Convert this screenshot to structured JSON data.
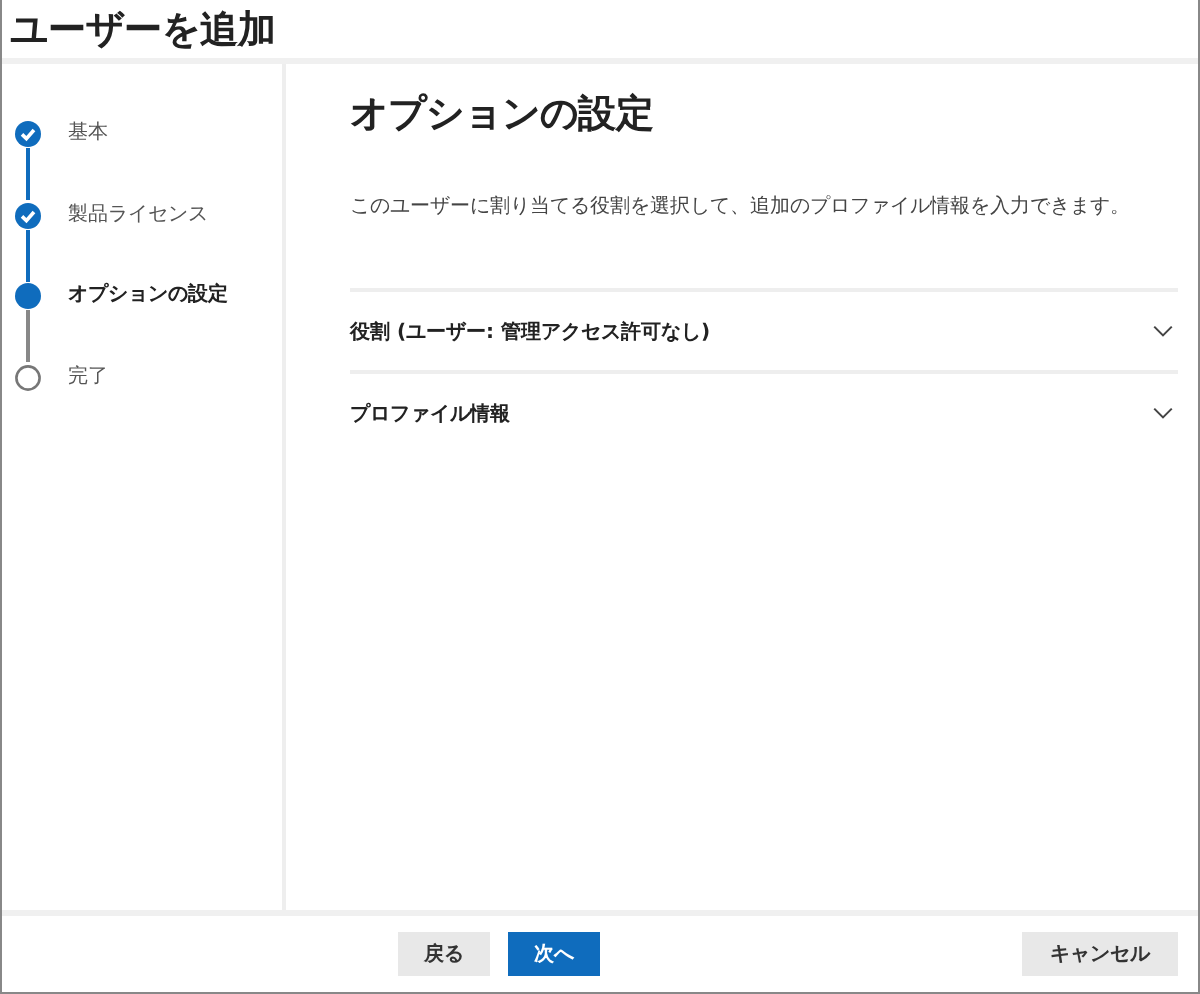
{
  "window": {
    "title": "ユーザーを追加"
  },
  "steps": [
    {
      "label": "基本",
      "kind": "done",
      "selected": false
    },
    {
      "label": "製品ライセンス",
      "kind": "done",
      "selected": false
    },
    {
      "label": "オプションの設定",
      "kind": "current",
      "selected": true
    },
    {
      "label": "完了",
      "kind": "pending",
      "selected": false
    }
  ],
  "main": {
    "heading": "オプションの設定",
    "description": "このユーザーに割り当てる役割を選択して、追加のプロファイル情報を入力できます。",
    "sections": [
      {
        "label": "役割 (ユーザー: 管理アクセス許可なし)",
        "expanded": false
      },
      {
        "label": "プロファイル情報",
        "expanded": false
      }
    ]
  },
  "footer": {
    "back": "戻る",
    "next": "次へ",
    "cancel": "キャンセル"
  }
}
